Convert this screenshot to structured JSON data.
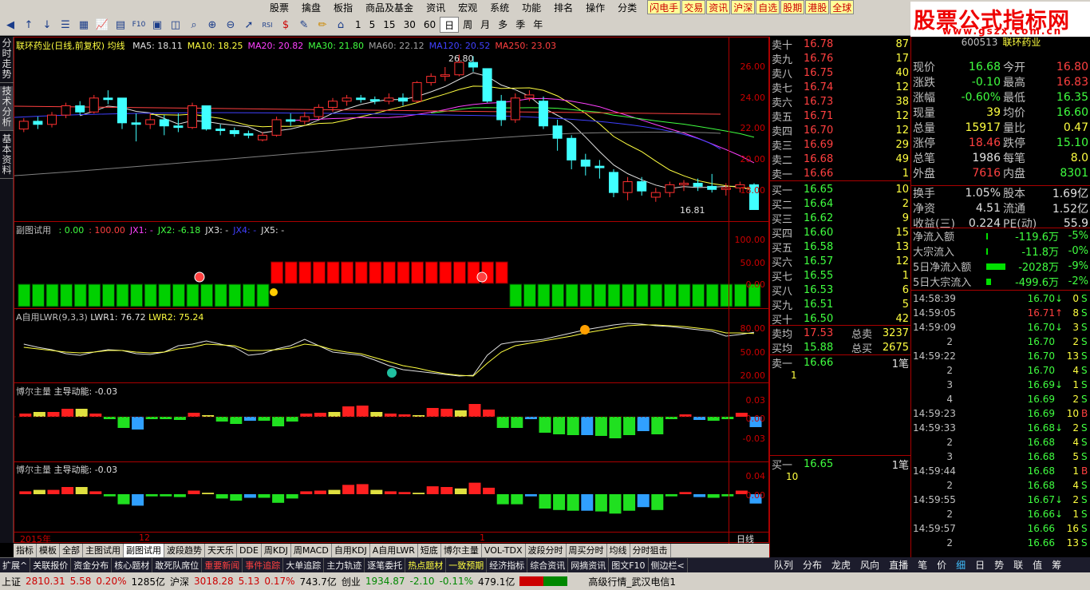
{
  "menu": [
    "股票",
    "擒盘",
    "板指",
    "商品及基金",
    "资讯",
    "宏观",
    "系统",
    "功能",
    "排名",
    "操作",
    "分类"
  ],
  "menu_tags": [
    "闪电手",
    "交易",
    "资讯",
    "沪深",
    "自选",
    "股期",
    "港股",
    "全球"
  ],
  "toolbar": {
    "periods": [
      "1",
      "5",
      "15",
      "30",
      "60",
      "日",
      "周",
      "月",
      "多",
      "季",
      "年"
    ],
    "selected": "日"
  },
  "logo": {
    "title": "股票公式指标网",
    "url": "www.gszx.com.cn"
  },
  "vtabs": [
    "分时走势",
    "技术分析",
    "基本资料"
  ],
  "main": {
    "title": "联环药业(日线,前复权) 均线",
    "ma": [
      {
        "label": "MA5: 18.11",
        "color": "#e0e0e0"
      },
      {
        "label": "MA10: 18.25",
        "color": "#ffff40"
      },
      {
        "label": "MA20: 20.82",
        "color": "#ff40ff"
      },
      {
        "label": "MA30: 21.80",
        "color": "#40ff40"
      },
      {
        "label": "MA60: 22.12",
        "color": "#a0a0a0"
      },
      {
        "label": "MA120: 20.52",
        "color": "#4040ff"
      },
      {
        "label": "MA250: 23.03",
        "color": "#ff4040"
      }
    ],
    "axis": [
      "26.00",
      "24.00",
      "22.00",
      "20.00",
      "18.00"
    ],
    "high_label": "26.80",
    "low_label": "16.81"
  },
  "sub1": {
    "title": "副图试用",
    "values": [
      {
        "t": ": 0.00",
        "c": "#40ff40"
      },
      {
        "t": ": 100.00",
        "c": "#ff4040"
      },
      {
        "t": "JX1: -",
        "c": "#ff40ff"
      },
      {
        "t": "JX2: -6.18",
        "c": "#40ff40"
      },
      {
        "t": "JX3: -",
        "c": "#e0e0e0"
      },
      {
        "t": "JX4: -",
        "c": "#4040ff"
      },
      {
        "t": "JX5: -",
        "c": "#e0e0e0"
      }
    ],
    "axis": [
      "100.00",
      "50.00",
      "0.00"
    ]
  },
  "sub2": {
    "title": "A自用LWR(9,3,3)",
    "v1": "LWR1: 76.72",
    "v2": "LWR2: 75.24",
    "axis": [
      "80.00",
      "50.00",
      "20.00"
    ]
  },
  "sub3": {
    "title": "博尔主量",
    "sub": "主导动能: -0.03",
    "axis": [
      "0.03",
      "0.00",
      "-0.03"
    ]
  },
  "sub4": {
    "title": "博尔主量",
    "sub": "主导动能: -0.03",
    "axis": [
      "0.04",
      "0.00"
    ]
  },
  "xaxis": {
    "year": "2015年",
    "m12": "12",
    "m1": "1",
    "period": "日线"
  },
  "tabs": [
    "指标",
    "模板",
    "全部",
    "主图试用",
    "副图试用",
    "波段趋势",
    "天天乐",
    "DDE",
    "周KDJ",
    "周MACD",
    "自用KDJ",
    "A自用LWR",
    "短底",
    "博尔主量",
    "VOL-TDX",
    "波段分时",
    "周买分时",
    "均线",
    "分时狙击"
  ],
  "tabs_selected": "副图试用",
  "func": [
    "扩展^",
    "关联报价",
    "资金分布",
    "核心题材",
    "敢死队席位",
    "重要新闻",
    "事件追踪",
    "大单追踪",
    "主力轨迹",
    "逐笔委托",
    "热点题材",
    "一致预期",
    "经济指标",
    "综合资讯",
    "网摘资讯",
    "图文F10",
    "侧边栏<"
  ],
  "func_colors": [
    "#eee",
    "#eee",
    "#eee",
    "#eee",
    "#eee",
    "#ff4040",
    "#ff4040",
    "#eee",
    "#eee",
    "#eee",
    "#ffff40",
    "#ffff40",
    "#eee",
    "#eee",
    "#eee",
    "#eee",
    "#eee"
  ],
  "status": {
    "sh_label": "上证",
    "sh_val": "2810.31",
    "sh_chg": "5.58",
    "sh_pct": "0.20%",
    "sh_amt": "1285亿",
    "hs_label": "沪深",
    "hs_val": "3018.28",
    "hs_chg": "5.13",
    "hs_pct": "0.17%",
    "hs_amt": "743.7亿",
    "cy_label": "创业",
    "cy_val": "1934.87",
    "cy_chg": "-2.10",
    "cy_pct": "-0.11%",
    "cy_amt": "479.1亿",
    "right": "高级行情_武汉电信1"
  },
  "orderbook": {
    "sell": [
      {
        "l": "卖十",
        "p": "16.78",
        "v": "87"
      },
      {
        "l": "卖九",
        "p": "16.76",
        "v": "17"
      },
      {
        "l": "卖八",
        "p": "16.75",
        "v": "40"
      },
      {
        "l": "卖七",
        "p": "16.74",
        "v": "12"
      },
      {
        "l": "卖六",
        "p": "16.73",
        "v": "38"
      },
      {
        "l": "卖五",
        "p": "16.71",
        "v": "12"
      },
      {
        "l": "卖四",
        "p": "16.70",
        "v": "12"
      },
      {
        "l": "卖三",
        "p": "16.69",
        "v": "29"
      },
      {
        "l": "卖二",
        "p": "16.68",
        "v": "49"
      },
      {
        "l": "卖一",
        "p": "16.66",
        "v": "1"
      }
    ],
    "buy": [
      {
        "l": "买一",
        "p": "16.65",
        "v": "10"
      },
      {
        "l": "买二",
        "p": "16.64",
        "v": "2"
      },
      {
        "l": "买三",
        "p": "16.62",
        "v": "9"
      },
      {
        "l": "买四",
        "p": "16.60",
        "v": "15"
      },
      {
        "l": "买五",
        "p": "16.58",
        "v": "13"
      },
      {
        "l": "买六",
        "p": "16.57",
        "v": "12"
      },
      {
        "l": "买七",
        "p": "16.55",
        "v": "1"
      },
      {
        "l": "买八",
        "p": "16.53",
        "v": "6"
      },
      {
        "l": "买九",
        "p": "16.51",
        "v": "5"
      },
      {
        "l": "买十",
        "p": "16.50",
        "v": "42"
      }
    ],
    "sell_avg_l": "卖均",
    "sell_avg": "17.53",
    "sell_tot_l": "总卖",
    "sell_tot": "3237",
    "buy_avg_l": "买均",
    "buy_avg": "15.88",
    "buy_tot_l": "总买",
    "buy_tot": "2675",
    "s1_l": "卖一",
    "s1_p": "16.66",
    "s1_n": "1笔",
    "s1_q": "1",
    "b1_l": "买一",
    "b1_p": "16.65",
    "b1_n": "1笔",
    "b1_q": "10"
  },
  "quote": {
    "code": "600513",
    "name": "联环药业",
    "rows": [
      {
        "a": "现价",
        "av": "16.68",
        "b": "今开",
        "bv": "16.80",
        "ac": "#40ff40",
        "bc": "#ff4040"
      },
      {
        "a": "涨跌",
        "av": "-0.10",
        "b": "最高",
        "bv": "16.83",
        "ac": "#40ff40",
        "bc": "#ff4040"
      },
      {
        "a": "涨幅",
        "av": "-0.60%",
        "b": "最低",
        "bv": "16.35",
        "ac": "#40ff40",
        "bc": "#40ff40"
      },
      {
        "a": "现量",
        "av": "39",
        "b": "均价",
        "bv": "16.60",
        "ac": "#ffff40",
        "bc": "#40ff40"
      },
      {
        "a": "总量",
        "av": "15917",
        "b": "量比",
        "bv": "0.47",
        "ac": "#ffff40",
        "bc": "#ffff40"
      },
      {
        "a": "涨停",
        "av": "18.46",
        "b": "跌停",
        "bv": "15.10",
        "ac": "#ff4040",
        "bc": "#40ff40"
      },
      {
        "a": "总笔",
        "av": "1986",
        "b": "每笔",
        "bv": "8.0",
        "ac": "#e0e0e0",
        "bc": "#ffff40"
      },
      {
        "a": "外盘",
        "av": "7616",
        "b": "内盘",
        "bv": "8301",
        "ac": "#ff4040",
        "bc": "#40ff40"
      },
      {
        "a": "换手",
        "av": "1.05%",
        "b": "股本",
        "bv": "1.69亿",
        "ac": "#e0e0e0",
        "bc": "#e0e0e0"
      },
      {
        "a": "净资",
        "av": "4.51",
        "b": "流通",
        "bv": "1.52亿",
        "ac": "#e0e0e0",
        "bc": "#e0e0e0"
      },
      {
        "a": "收益(三)",
        "av": "0.224",
        "b": "PE(动)",
        "bv": "55.9",
        "ac": "#e0e0e0",
        "bc": "#e0e0e0"
      }
    ],
    "flows": [
      {
        "l": "净流入额",
        "v": "-119.6万",
        "p": "-5%",
        "bar": 0.05
      },
      {
        "l": "大宗流入",
        "v": "-11.8万",
        "p": "-0%",
        "bar": 0.02
      },
      {
        "l": "5日净流入额",
        "v": "-2028万",
        "p": "-9%",
        "bar": 0.6
      },
      {
        "l": "5日大宗流入",
        "v": "-499.6万",
        "p": "-2%",
        "bar": 0.15
      }
    ]
  },
  "ticks": [
    {
      "t": "14:58:39",
      "p": "16.70",
      "a": "↓",
      "v": "0",
      "s": "S"
    },
    {
      "t": "14:59:05",
      "p": "16.71",
      "a": "↑",
      "v": "8",
      "s": "S"
    },
    {
      "t": "14:59:09",
      "p": "16.70",
      "a": "↓",
      "v": "3",
      "s": "S"
    },
    {
      "t": "2",
      "p": "16.70",
      "a": "",
      "v": "2",
      "s": "S"
    },
    {
      "t": "14:59:22",
      "p": "16.70",
      "a": "",
      "v": "13",
      "s": "S"
    },
    {
      "t": "2",
      "p": "16.70",
      "a": "",
      "v": "4",
      "s": "S"
    },
    {
      "t": "3",
      "p": "16.69",
      "a": "↓",
      "v": "1",
      "s": "S"
    },
    {
      "t": "4",
      "p": "16.69",
      "a": "",
      "v": "2",
      "s": "S"
    },
    {
      "t": "14:59:23",
      "p": "16.69",
      "a": "",
      "v": "10",
      "s": "B"
    },
    {
      "t": "14:59:33",
      "p": "16.68",
      "a": "↓",
      "v": "2",
      "s": "S"
    },
    {
      "t": "2",
      "p": "16.68",
      "a": "",
      "v": "4",
      "s": "S"
    },
    {
      "t": "3",
      "p": "16.68",
      "a": "",
      "v": "5",
      "s": "S"
    },
    {
      "t": "14:59:44",
      "p": "16.68",
      "a": "",
      "v": "1",
      "s": "B"
    },
    {
      "t": "2",
      "p": "16.68",
      "a": "",
      "v": "4",
      "s": "S"
    },
    {
      "t": "14:59:55",
      "p": "16.67",
      "a": "↓",
      "v": "2",
      "s": "S"
    },
    {
      "t": "2",
      "p": "16.66",
      "a": "↓",
      "v": "1",
      "s": "S"
    },
    {
      "t": "14:59:57",
      "p": "16.66",
      "a": "",
      "v": "16",
      "s": "S"
    },
    {
      "t": "2",
      "p": "16.66",
      "a": "",
      "v": "13",
      "s": "S"
    }
  ],
  "right_tabs": [
    "队列",
    "分布",
    "龙虎",
    "风向",
    "直播",
    "笔",
    "价",
    "细",
    "日",
    "势",
    "联",
    "值",
    "筹"
  ],
  "right_tabs_selected": "细",
  "candles": [
    {
      "o": 22.0,
      "c": 22.5,
      "h": 22.7,
      "l": 21.8
    },
    {
      "o": 22.5,
      "c": 22.3,
      "h": 22.8,
      "l": 22.0
    },
    {
      "o": 22.3,
      "c": 22.9,
      "h": 23.1,
      "l": 22.1
    },
    {
      "o": 22.9,
      "c": 23.5,
      "h": 23.7,
      "l": 22.7
    },
    {
      "o": 23.5,
      "c": 23.1,
      "h": 23.8,
      "l": 22.9
    },
    {
      "o": 23.1,
      "c": 24.0,
      "h": 24.2,
      "l": 23.0
    },
    {
      "o": 24.0,
      "c": 23.9,
      "h": 24.5,
      "l": 23.6
    },
    {
      "o": 24.0,
      "c": 22.4,
      "h": 24.0,
      "l": 22.0
    },
    {
      "o": 22.4,
      "c": 22.3,
      "h": 23.0,
      "l": 21.2
    },
    {
      "o": 22.3,
      "c": 22.6,
      "h": 23.0,
      "l": 22.0
    },
    {
      "o": 22.6,
      "c": 22.2,
      "h": 22.9,
      "l": 21.6
    },
    {
      "o": 22.2,
      "c": 22.1,
      "h": 23.0,
      "l": 21.8
    },
    {
      "o": 22.1,
      "c": 23.5,
      "h": 23.7,
      "l": 22.0
    },
    {
      "o": 23.5,
      "c": 22.0,
      "h": 23.5,
      "l": 21.9
    },
    {
      "o": 22.0,
      "c": 21.9,
      "h": 22.3,
      "l": 21.6
    },
    {
      "o": 21.9,
      "c": 21.7,
      "h": 22.1,
      "l": 21.5
    },
    {
      "o": 21.7,
      "c": 21.6,
      "h": 21.9,
      "l": 21.4
    },
    {
      "o": 21.3,
      "c": 21.6,
      "h": 21.8,
      "l": 21.2
    },
    {
      "o": 21.6,
      "c": 22.6,
      "h": 22.8,
      "l": 21.5
    },
    {
      "o": 22.6,
      "c": 22.5,
      "h": 23.0,
      "l": 22.2
    },
    {
      "o": 22.5,
      "c": 22.8,
      "h": 23.1,
      "l": 22.3
    },
    {
      "o": 22.8,
      "c": 23.4,
      "h": 23.6,
      "l": 22.6
    },
    {
      "o": 23.4,
      "c": 23.8,
      "h": 24.0,
      "l": 23.1
    },
    {
      "o": 23.8,
      "c": 24.0,
      "h": 24.2,
      "l": 23.5
    },
    {
      "o": 24.0,
      "c": 23.9,
      "h": 24.2,
      "l": 23.7
    },
    {
      "o": 23.9,
      "c": 23.8,
      "h": 24.1,
      "l": 23.6
    },
    {
      "o": 23.8,
      "c": 24.0,
      "h": 24.3,
      "l": 23.6
    },
    {
      "o": 24.0,
      "c": 23.8,
      "h": 24.3,
      "l": 23.5
    },
    {
      "o": 23.8,
      "c": 25.0,
      "h": 25.1,
      "l": 23.7
    },
    {
      "o": 25.0,
      "c": 25.4,
      "h": 25.6,
      "l": 24.8
    },
    {
      "o": 25.4,
      "c": 25.5,
      "h": 26.0,
      "l": 25.1
    },
    {
      "o": 25.5,
      "c": 26.3,
      "h": 26.8,
      "l": 25.4
    },
    {
      "o": 26.3,
      "c": 26.0,
      "h": 26.7,
      "l": 25.7
    },
    {
      "o": 25.9,
      "c": 23.8,
      "h": 25.9,
      "l": 23.7
    },
    {
      "o": 23.8,
      "c": 22.6,
      "h": 24.2,
      "l": 22.2
    },
    {
      "o": 22.6,
      "c": 24.0,
      "h": 24.3,
      "l": 22.4
    },
    {
      "o": 24.0,
      "c": 24.2,
      "h": 24.5,
      "l": 23.8
    },
    {
      "o": 23.8,
      "c": 22.2,
      "h": 24.1,
      "l": 22.0
    },
    {
      "o": 22.2,
      "c": 21.4,
      "h": 22.6,
      "l": 20.6
    },
    {
      "o": 21.4,
      "c": 20.0,
      "h": 21.6,
      "l": 19.4
    },
    {
      "o": 20.0,
      "c": 19.6,
      "h": 20.4,
      "l": 19.0
    },
    {
      "o": 19.6,
      "c": 19.5,
      "h": 20.0,
      "l": 18.8
    },
    {
      "o": 19.2,
      "c": 17.9,
      "h": 19.4,
      "l": 17.6
    },
    {
      "o": 17.9,
      "c": 18.6,
      "h": 18.9,
      "l": 17.4
    },
    {
      "o": 18.6,
      "c": 18.0,
      "h": 18.9,
      "l": 17.7
    },
    {
      "o": 17.6,
      "c": 17.9,
      "h": 18.2,
      "l": 17.3
    },
    {
      "o": 17.9,
      "c": 18.4,
      "h": 18.6,
      "l": 17.6
    },
    {
      "o": 18.4,
      "c": 18.5,
      "h": 18.7,
      "l": 18.0
    },
    {
      "o": 18.5,
      "c": 18.3,
      "h": 18.8,
      "l": 18.0
    },
    {
      "o": 18.3,
      "c": 18.1,
      "h": 19.1,
      "l": 17.9
    },
    {
      "o": 18.1,
      "c": 18.2,
      "h": 18.5,
      "l": 17.7
    },
    {
      "o": 18.2,
      "c": 18.4,
      "h": 18.6,
      "l": 17.9
    },
    {
      "o": 18.4,
      "c": 16.8,
      "h": 18.5,
      "l": 16.8
    }
  ],
  "vol": [
    0.4,
    0.6,
    0.6,
    1.0,
    1.0,
    0.4,
    -0.3,
    -1.4,
    -1.6,
    -0.3,
    -0.3,
    -0.4,
    0.5,
    0.2,
    -0.6,
    -0.9,
    -0.5,
    -0.5,
    -1.2,
    -0.6,
    0.4,
    0.5,
    0.6,
    1.3,
    1.4,
    0.6,
    0.4,
    0.3,
    0.2,
    1.1,
    1.0,
    0.8,
    1.6,
    0.9,
    -1.4,
    -1.4,
    -0.3,
    -2.0,
    -2.2,
    -2.3,
    -2.3,
    -2.4,
    -2.7,
    -2.3,
    -1.8,
    -2.2,
    -0.3,
    0.3,
    -0.4,
    -0.5,
    -0.3,
    0.5,
    -1.3
  ],
  "flags": [
    0,
    0,
    0,
    0,
    0,
    0,
    0,
    0,
    0,
    0,
    0,
    0,
    0,
    0,
    0,
    0,
    0,
    0,
    1,
    1,
    1,
    1,
    1,
    1,
    1,
    1,
    1,
    1,
    1,
    1,
    1,
    1,
    1,
    1,
    1,
    0,
    0,
    0,
    0,
    0,
    0,
    0,
    0,
    0,
    0,
    0,
    0,
    0,
    0,
    0,
    0,
    0,
    0
  ],
  "lwr1": [
    62,
    58,
    55,
    50,
    48,
    52,
    55,
    54,
    50,
    49,
    52,
    60,
    62,
    66,
    62,
    58,
    48,
    50,
    56,
    60,
    68,
    60,
    52,
    50,
    48,
    42,
    35,
    30,
    28,
    26,
    24,
    22,
    23,
    48,
    62,
    65,
    66,
    68,
    72,
    76,
    80,
    83,
    86,
    88,
    87,
    85,
    84,
    82,
    80,
    78,
    72,
    74,
    76.7
  ],
  "lwr2": [
    58,
    56,
    54,
    52,
    51,
    52,
    54,
    54,
    52,
    51,
    52,
    56,
    58,
    62,
    61,
    60,
    54,
    54,
    55,
    57,
    62,
    60,
    55,
    52,
    50,
    45,
    40,
    35,
    32,
    28,
    25,
    23,
    22,
    38,
    52,
    60,
    63,
    66,
    69,
    72,
    76,
    79,
    82,
    85,
    86,
    86,
    85,
    84,
    82,
    80,
    76,
    76,
    75.2
  ]
}
